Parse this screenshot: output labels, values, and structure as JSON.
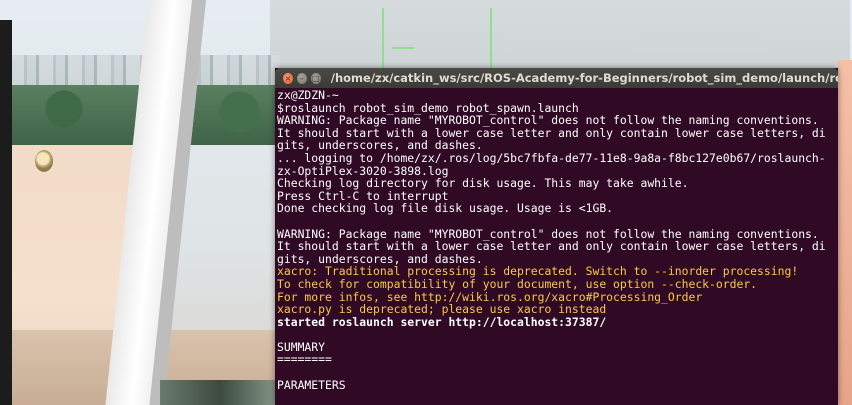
{
  "terminal": {
    "title": "/home/zx/catkin_ws/src/ROS-Academy-for-Beginners/robot_sim_demo/launch/robot_spa",
    "buttons": {
      "close": "×",
      "minimize": "–",
      "maximize": "□"
    },
    "lines": [
      {
        "text": "zx@ZDZN-~",
        "style": "normal"
      },
      {
        "text": "$roslaunch robot_sim_demo robot_spawn.launch",
        "style": "normal"
      },
      {
        "text": "WARNING: Package name \"MYROBOT_control\" does not follow the naming conventions.",
        "style": "normal"
      },
      {
        "text": "It should start with a lower case letter and only contain lower case letters, di",
        "style": "normal"
      },
      {
        "text": "gits, underscores, and dashes.",
        "style": "normal"
      },
      {
        "text": "... logging to /home/zx/.ros/log/5bc7fbfa-de77-11e8-9a8a-f8bc127e0b67/roslaunch-",
        "style": "normal"
      },
      {
        "text": "zx-OptiPlex-3020-3898.log",
        "style": "normal"
      },
      {
        "text": "Checking log directory for disk usage. This may take awhile.",
        "style": "normal"
      },
      {
        "text": "Press Ctrl-C to interrupt",
        "style": "normal"
      },
      {
        "text": "Done checking log file disk usage. Usage is <1GB.",
        "style": "normal"
      },
      {
        "text": "",
        "style": "normal"
      },
      {
        "text": "WARNING: Package name \"MYROBOT_control\" does not follow the naming conventions.",
        "style": "normal"
      },
      {
        "text": "It should start with a lower case letter and only contain lower case letters, di",
        "style": "normal"
      },
      {
        "text": "gits, underscores, and dashes.",
        "style": "normal"
      },
      {
        "text": "xacro: Traditional processing is deprecated. Switch to --inorder processing!",
        "style": "warn"
      },
      {
        "text": "To check for compatibility of your document, use option --check-order.",
        "style": "warn"
      },
      {
        "text": "For more infos, see http://wiki.ros.org/xacro#Processing_Order",
        "style": "warn"
      },
      {
        "text": "xacro.py is deprecated; please use xacro instead",
        "style": "warn"
      },
      {
        "text": "started roslaunch server http://localhost:37387/",
        "style": "bold"
      },
      {
        "text": "",
        "style": "normal"
      },
      {
        "text": "SUMMARY",
        "style": "normal"
      },
      {
        "text": "========",
        "style": "normal"
      },
      {
        "text": "",
        "style": "normal"
      },
      {
        "text": "PARAMETERS",
        "style": "normal"
      }
    ]
  },
  "colors": {
    "terminal_bg": "#300a24",
    "terminal_text": "#ffffff",
    "warning_text": "#f8ca48",
    "titlebar": "#3b3a36"
  }
}
